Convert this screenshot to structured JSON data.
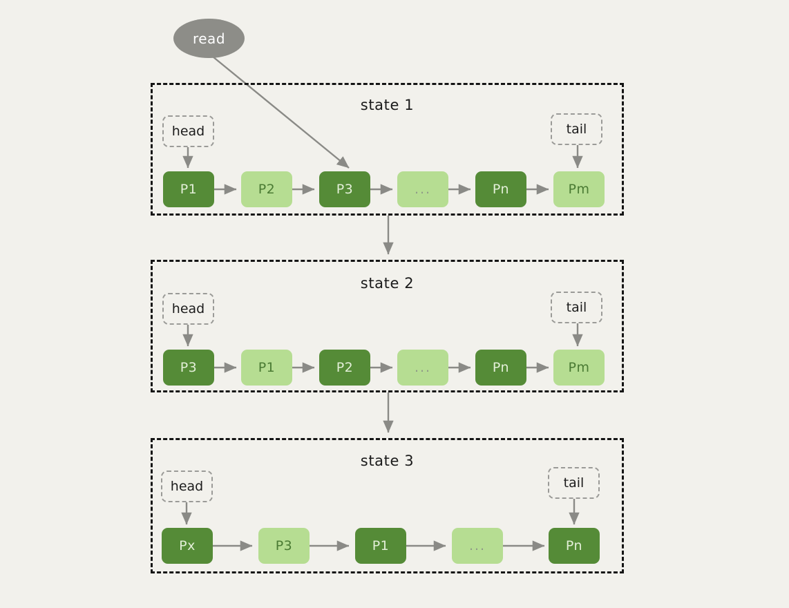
{
  "diagram": {
    "background_color": "#f2f1ec",
    "node_dark_color": "#558b37",
    "node_light_color": "#b6dd92",
    "arrow_color": "#8a8a86",
    "border_color": "#141414",
    "pointer_border_color": "#9a9a97",
    "read_bubble_color": "#8d8d88"
  },
  "read": {
    "label": "read"
  },
  "states": [
    {
      "title": "state 1",
      "head_label": "head",
      "tail_label": "tail",
      "nodes": [
        {
          "label": "P1",
          "style": "dark"
        },
        {
          "label": "P2",
          "style": "light"
        },
        {
          "label": "P3",
          "style": "dark"
        },
        {
          "label": "...",
          "style": "ellipsis"
        },
        {
          "label": "Pn",
          "style": "dark"
        },
        {
          "label": "Pm",
          "style": "light"
        }
      ]
    },
    {
      "title": "state 2",
      "head_label": "head",
      "tail_label": "tail",
      "nodes": [
        {
          "label": "P3",
          "style": "dark"
        },
        {
          "label": "P1",
          "style": "light"
        },
        {
          "label": "P2",
          "style": "dark"
        },
        {
          "label": "...",
          "style": "ellipsis"
        },
        {
          "label": "Pn",
          "style": "dark"
        },
        {
          "label": "Pm",
          "style": "light"
        }
      ]
    },
    {
      "title": "state 3",
      "head_label": "head",
      "tail_label": "tail",
      "nodes": [
        {
          "label": "Px",
          "style": "dark"
        },
        {
          "label": "P3",
          "style": "light"
        },
        {
          "label": "P1",
          "style": "dark"
        },
        {
          "label": "...",
          "style": "ellipsis"
        },
        {
          "label": "Pn",
          "style": "dark"
        }
      ]
    }
  ]
}
